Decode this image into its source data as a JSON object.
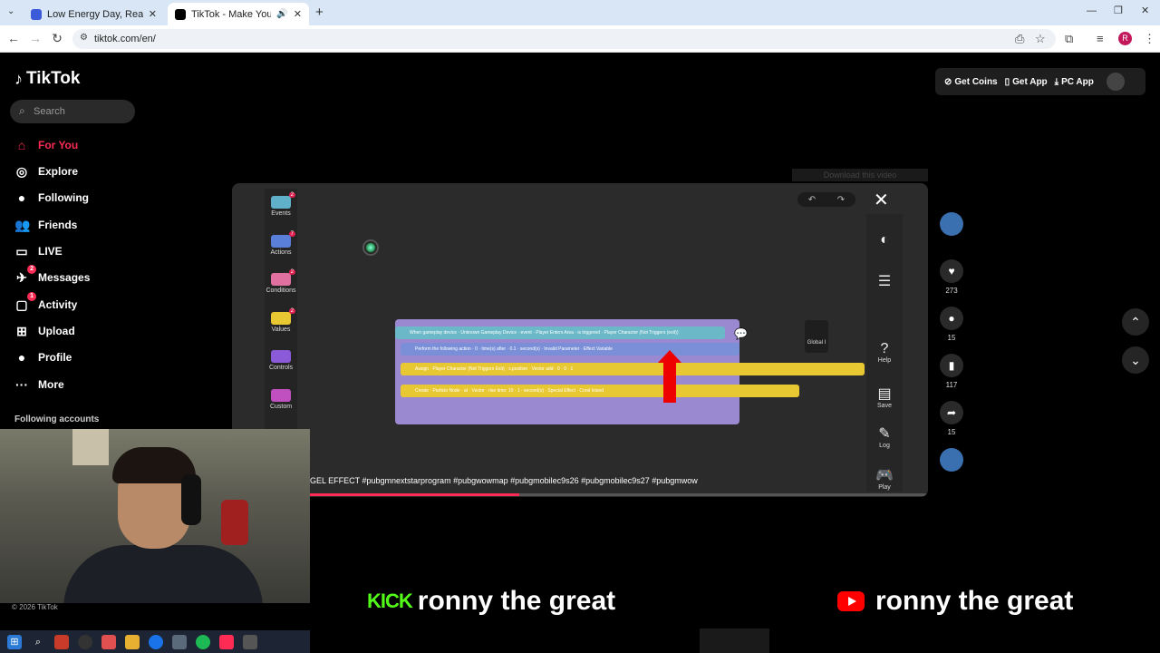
{
  "browser": {
    "tabs": [
      {
        "title": "Low Energy Day, Real Talk & Ch",
        "favicon_color": "#3b5bdb",
        "active": false
      },
      {
        "title": "TikTok - Make Your Day",
        "favicon_color": "#000000",
        "active": true
      }
    ],
    "new_tab": "+",
    "url": "tiktok.com/en/",
    "profile_initial": "R"
  },
  "tiktok": {
    "logo": "TikTok",
    "search_placeholder": "Search",
    "nav": [
      {
        "label": "For You",
        "icon": "home-icon",
        "glyph": "⌂",
        "active": true
      },
      {
        "label": "Explore",
        "icon": "compass-icon",
        "glyph": "◎"
      },
      {
        "label": "Following",
        "icon": "following-avatar-icon",
        "glyph": "●"
      },
      {
        "label": "Friends",
        "icon": "friends-icon",
        "glyph": "👥"
      },
      {
        "label": "LIVE",
        "icon": "live-icon",
        "glyph": "▭"
      },
      {
        "label": "Messages",
        "icon": "messages-icon",
        "glyph": "✈",
        "badge": "2"
      },
      {
        "label": "Activity",
        "icon": "activity-icon",
        "glyph": "▢",
        "badge": "1"
      },
      {
        "label": "Upload",
        "icon": "upload-icon",
        "glyph": "⊞"
      },
      {
        "label": "Profile",
        "icon": "profile-icon",
        "glyph": "●"
      },
      {
        "label": "More",
        "icon": "more-icon",
        "glyph": "···"
      }
    ],
    "following_accounts": "Following accounts",
    "top_buttons": {
      "coins": "Get Coins",
      "app": "Get App",
      "pc": "PC App"
    },
    "copyright": "© 2026 TikTok"
  },
  "video": {
    "download_banner": "Download this video",
    "caption": "GEL EFFECT #pubgmnextstarprogram #pubgwowmap #pubgmobilec9s26 #pubgmobilec9s27 #pubgmwow",
    "progress": 0.34,
    "palette": [
      {
        "label": "Events",
        "color": "#5fb0c8",
        "badge": "2"
      },
      {
        "label": "Actions",
        "color": "#5a7fd8",
        "badge": "7"
      },
      {
        "label": "Conditions",
        "color": "#e070a0",
        "badge": "2"
      },
      {
        "label": "Values",
        "color": "#e8c832",
        "badge": "2"
      },
      {
        "label": "Controls",
        "color": "#8a5ad8"
      },
      {
        "label": "Custom",
        "color": "#c050c0"
      }
    ],
    "right_panel": [
      {
        "label": "",
        "icon": "color-wheel-icon"
      },
      {
        "label": "",
        "icon": "list-icon"
      },
      {
        "label": "Help",
        "icon": "help-icon"
      },
      {
        "label": "Save",
        "icon": "save-icon"
      },
      {
        "label": "Log",
        "icon": "log-icon"
      },
      {
        "label": "Play",
        "icon": "gamepad-icon"
      }
    ],
    "global_label": "Global I",
    "code_rows": [
      {
        "text": "When gameplay device · Unknown Gameplay Device · event · Player Enters Area · is triggered · Player Character (Not Triggers (exit))",
        "color": "#6ab8c8"
      },
      {
        "text": "Perform the following action · 0 · time(s) after · 0.1 · second(s) · Invalid Parameter · Effect Variable",
        "color": "#7a8fd8"
      },
      {
        "text": "Assign · Player Character (Not Triggers Exit) · s.position · Vector add · 0 · 0 · 1",
        "color": "#e8c832"
      },
      {
        "text": "Create · Particle Node · at · Vector · rise time: 10 · 1 · second(s) · Special Effect · Coral Island",
        "color": "#e8c832"
      }
    ]
  },
  "actions": {
    "likes": "273",
    "comments": "15",
    "saves": "117",
    "shares": "15"
  },
  "overlay": {
    "kick_logo": "KICK",
    "kick_name": "ronny the great",
    "youtube_name": "ronny the great"
  }
}
